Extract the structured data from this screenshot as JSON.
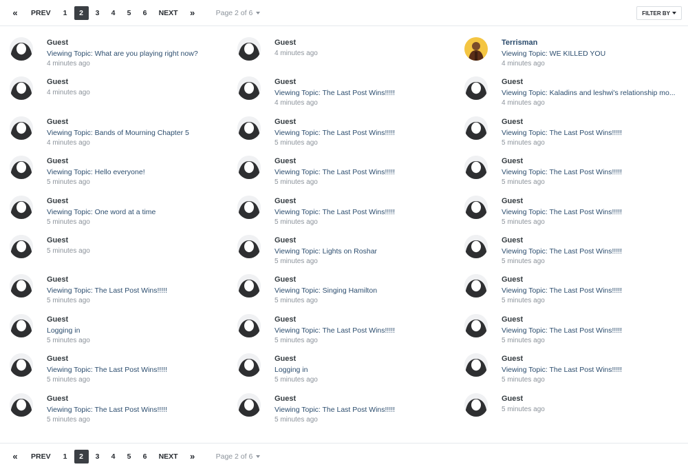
{
  "pagination": {
    "first_label": "«",
    "prev_label": "PREV",
    "pages": [
      "1",
      "2",
      "3",
      "4",
      "5",
      "6"
    ],
    "current": "2",
    "next_label": "NEXT",
    "last_label": "»",
    "page_of": "Page 2 of 6"
  },
  "filter_label": "FILTER BY",
  "columns": [
    [
      {
        "name": "Guest",
        "topic": "Viewing Topic: What are you playing right now?",
        "time": "4 minutes ago"
      },
      {
        "name": "Guest",
        "topic": "",
        "time": "4 minutes ago"
      },
      {
        "name": "Guest",
        "topic": "Viewing Topic: Bands of Mourning Chapter 5",
        "time": "4 minutes ago"
      },
      {
        "name": "Guest",
        "topic": "Viewing Topic: Hello everyone!",
        "time": "5 minutes ago"
      },
      {
        "name": "Guest",
        "topic": "Viewing Topic: One word at a time",
        "time": "5 minutes ago"
      },
      {
        "name": "Guest",
        "topic": "",
        "time": "5 minutes ago"
      },
      {
        "name": "Guest",
        "topic": "Viewing Topic: The Last Post Wins!!!!!",
        "time": "5 minutes ago"
      },
      {
        "name": "Guest",
        "topic": "Logging in",
        "time": "5 minutes ago"
      },
      {
        "name": "Guest",
        "topic": "Viewing Topic: The Last Post Wins!!!!!",
        "time": "5 minutes ago"
      },
      {
        "name": "Guest",
        "topic": "Viewing Topic: The Last Post Wins!!!!!",
        "time": "5 minutes ago"
      }
    ],
    [
      {
        "name": "Guest",
        "topic": "",
        "time": "4 minutes ago"
      },
      {
        "name": "Guest",
        "topic": "Viewing Topic: The Last Post Wins!!!!!",
        "time": "4 minutes ago"
      },
      {
        "name": "Guest",
        "topic": "Viewing Topic: The Last Post Wins!!!!!",
        "time": "5 minutes ago"
      },
      {
        "name": "Guest",
        "topic": "Viewing Topic: The Last Post Wins!!!!!",
        "time": "5 minutes ago"
      },
      {
        "name": "Guest",
        "topic": "Viewing Topic: The Last Post Wins!!!!!",
        "time": "5 minutes ago"
      },
      {
        "name": "Guest",
        "topic": "Viewing Topic: Lights on Roshar",
        "time": "5 minutes ago"
      },
      {
        "name": "Guest",
        "topic": "Viewing Topic: Singing Hamilton",
        "time": "5 minutes ago"
      },
      {
        "name": "Guest",
        "topic": "Viewing Topic: The Last Post Wins!!!!!",
        "time": "5 minutes ago"
      },
      {
        "name": "Guest",
        "topic": "Logging in",
        "time": "5 minutes ago"
      },
      {
        "name": "Guest",
        "topic": "Viewing Topic: The Last Post Wins!!!!!",
        "time": "5 minutes ago"
      }
    ],
    [
      {
        "name": "Terrisman",
        "member": true,
        "topic": "Viewing Topic: WE KILLED YOU",
        "time": "4 minutes ago"
      },
      {
        "name": "Guest",
        "topic": "Viewing Topic: Kaladins and leshwi's relationship mo...",
        "time": "4 minutes ago"
      },
      {
        "name": "Guest",
        "topic": "Viewing Topic: The Last Post Wins!!!!!",
        "time": "5 minutes ago"
      },
      {
        "name": "Guest",
        "topic": "Viewing Topic: The Last Post Wins!!!!!",
        "time": "5 minutes ago"
      },
      {
        "name": "Guest",
        "topic": "Viewing Topic: The Last Post Wins!!!!!",
        "time": "5 minutes ago"
      },
      {
        "name": "Guest",
        "topic": "Viewing Topic: The Last Post Wins!!!!!",
        "time": "5 minutes ago"
      },
      {
        "name": "Guest",
        "topic": "Viewing Topic: The Last Post Wins!!!!!",
        "time": "5 minutes ago"
      },
      {
        "name": "Guest",
        "topic": "Viewing Topic: The Last Post Wins!!!!!",
        "time": "5 minutes ago"
      },
      {
        "name": "Guest",
        "topic": "Viewing Topic: The Last Post Wins!!!!!",
        "time": "5 minutes ago"
      },
      {
        "name": "Guest",
        "topic": "",
        "time": "5 minutes ago"
      }
    ]
  ]
}
